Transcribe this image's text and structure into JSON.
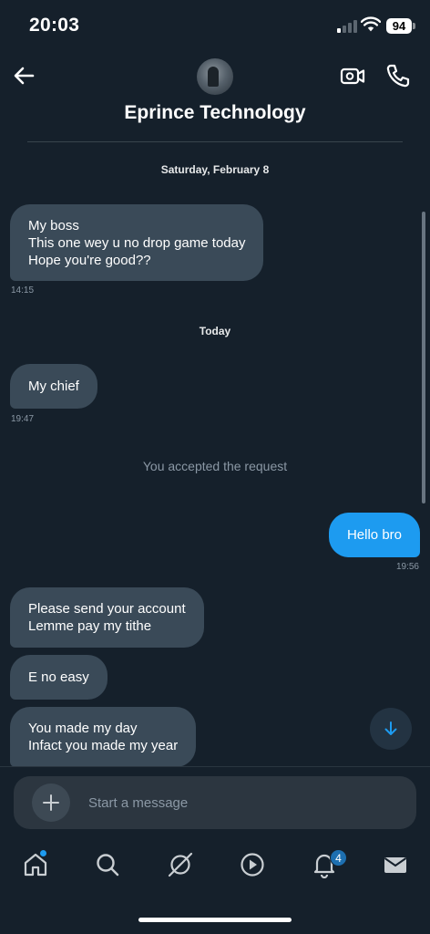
{
  "status_bar": {
    "time": "20:03",
    "battery": "94",
    "signal_bars_active": 1,
    "icons": [
      "signal-icon",
      "wifi-icon",
      "battery-icon"
    ]
  },
  "header": {
    "contact_name": "Eprince Technology",
    "icons": [
      "back-arrow-icon",
      "avatar",
      "video-call-icon",
      "phone-icon"
    ]
  },
  "conversation": {
    "date_separators": [
      "Saturday, February 8",
      "Today"
    ],
    "messages": [
      {
        "direction": "in",
        "lines": [
          "My boss",
          "This one wey u no drop game today",
          "Hope you're good??"
        ],
        "time": "14:15"
      },
      {
        "direction": "in",
        "lines": [
          "My chief"
        ],
        "time": "19:47"
      },
      {
        "direction": "out",
        "lines": [
          "Hello bro"
        ],
        "time": "19:56"
      },
      {
        "direction": "in",
        "lines": [
          "Please send your account",
          "Lemme pay my tithe"
        ]
      },
      {
        "direction": "in",
        "lines": [
          "E no easy"
        ]
      },
      {
        "direction": "in",
        "lines": [
          "You made my day",
          "Infact you made my year"
        ]
      }
    ],
    "system_note": "You accepted the request"
  },
  "composer": {
    "placeholder": "Start a message",
    "icons": [
      "plus-icon",
      "voice-waveform-icon"
    ]
  },
  "tab_bar": {
    "tabs": [
      "home",
      "search",
      "grok",
      "video",
      "notifications",
      "messages"
    ],
    "notifications_count": "4"
  },
  "colors": {
    "background": "#15202b",
    "incoming_bubble": "#3a4a58",
    "outgoing_bubble": "#1d9bf0",
    "muted_text": "#8b98a5",
    "voice_accent": "#7c5cff"
  }
}
